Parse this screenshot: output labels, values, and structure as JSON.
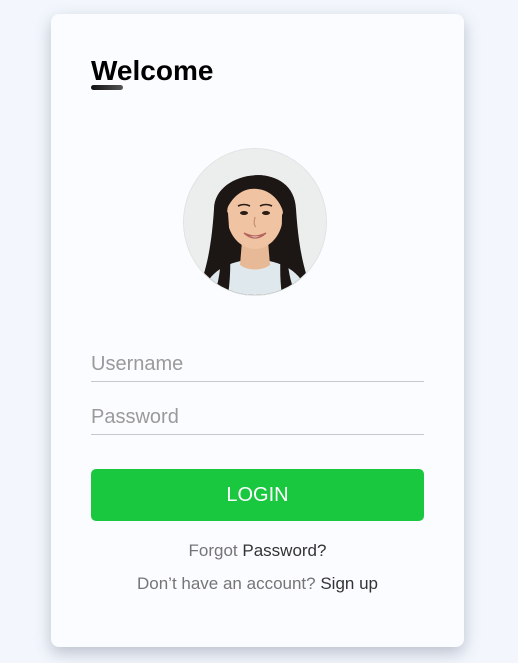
{
  "card": {
    "title": "Welcome"
  },
  "avatar": {
    "icon": "user-avatar-photo"
  },
  "form": {
    "username_placeholder": "Username",
    "username_value": "",
    "password_placeholder": "Password",
    "password_value": "",
    "login_label": "LOGIN"
  },
  "links": {
    "forgot_prefix": "Forgot",
    "forgot_link": "Password?",
    "signup_prefix": "Don’t have an account?",
    "signup_link": "Sign up"
  },
  "colors": {
    "accent": "#1ac840",
    "background": "#f3f7fd",
    "card": "#fbfcff"
  }
}
